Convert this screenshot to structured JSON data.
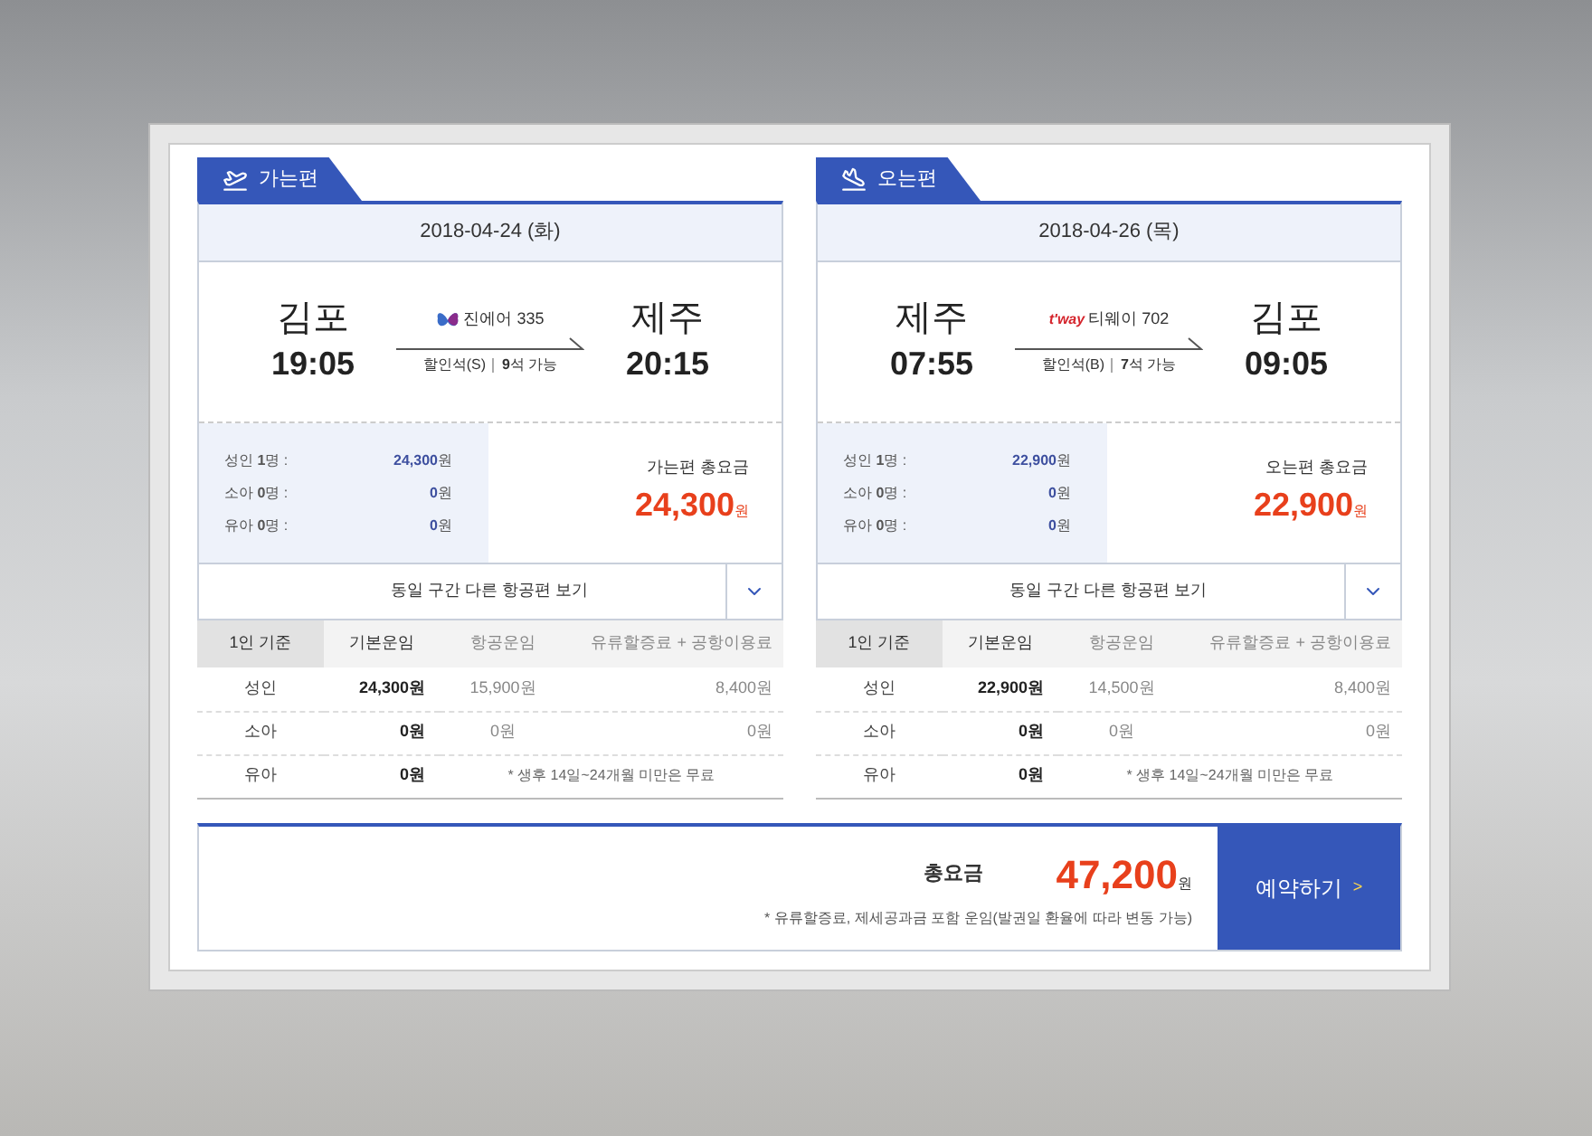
{
  "legs": [
    {
      "label": "가는편",
      "kind": "departure",
      "date": "2018-04-24 (화)",
      "from": "김포",
      "dep_time": "19:05",
      "to": "제주",
      "arr_time": "20:15",
      "airline": {
        "kind": "butterfly",
        "name": "진에어 335"
      },
      "seat_class": "할인석(S)",
      "seats": "**9**석 가능",
      "passengers": [
        {
          "label": "성인 **1**명 :",
          "amount": "**24,300**원"
        },
        {
          "label": "소아 **0**명 :",
          "amount": "**0**원"
        },
        {
          "label": "유아 **0**명 :",
          "amount": "**0**원"
        }
      ],
      "total_label": "가는편 총요금",
      "total": "**24,300**원",
      "other_flights": "동일 구간 다른 항공편 보기",
      "table": {
        "columns": [
          "1인 기준",
          "기본운임",
          "항공운임",
          "유류할증료 + 공항이용료"
        ],
        "rows": [
          {
            "kind": "fare",
            "cells": [
              "성인",
              "24,300원",
              "15,900원",
              "8,400원"
            ]
          },
          {
            "kind": "fare",
            "cells": [
              "소아",
              "0원",
              "0원",
              "0원"
            ]
          },
          {
            "kind": "note",
            "cells": [
              "유아",
              "0원",
              {
                "text": "* 생후 14일~24개월 미만은 무료",
                "colspan": 2
              }
            ]
          }
        ]
      }
    },
    {
      "label": "오는편",
      "kind": "arrival",
      "date": "2018-04-26 (목)",
      "from": "제주",
      "dep_time": "07:55",
      "to": "김포",
      "arr_time": "09:05",
      "airline": {
        "kind": "wordmark",
        "wordmark": "t'way",
        "name": "티웨이 702"
      },
      "seat_class": "할인석(B)",
      "seats": "**7**석 가능",
      "passengers": [
        {
          "label": "성인 **1**명 :",
          "amount": "**22,900**원"
        },
        {
          "label": "소아 **0**명 :",
          "amount": "**0**원"
        },
        {
          "label": "유아 **0**명 :",
          "amount": "**0**원"
        }
      ],
      "total_label": "오는편 총요금",
      "total": "**22,900**원",
      "other_flights": "동일 구간 다른 항공편 보기",
      "table": {
        "columns": [
          "1인 기준",
          "기본운임",
          "항공운임",
          "유류할증료 + 공항이용료"
        ],
        "rows": [
          {
            "kind": "fare",
            "cells": [
              "성인",
              "22,900원",
              "14,500원",
              "8,400원"
            ]
          },
          {
            "kind": "fare",
            "cells": [
              "소아",
              "0원",
              "0원",
              "0원"
            ]
          },
          {
            "kind": "note",
            "cells": [
              "유아",
              "0원",
              {
                "text": "* 생후 14일~24개월 미만은 무료",
                "colspan": 2
              }
            ]
          }
        ]
      }
    }
  ],
  "summary": {
    "label": "총요금",
    "total": "**47,200**원",
    "note": "* 유류할증료, 제세공과금 포함 운임(발권일 환율에 따라 변동 가능)",
    "button": "예약하기",
    "button_arrow": ">"
  }
}
